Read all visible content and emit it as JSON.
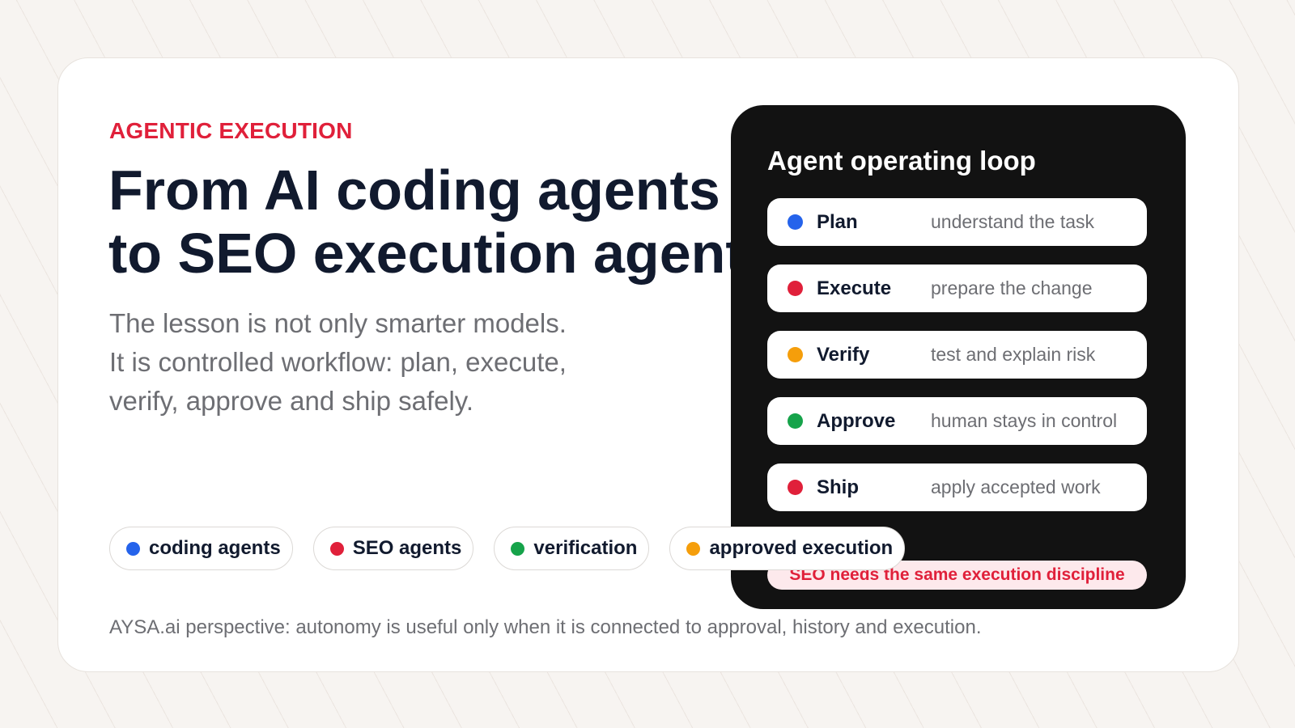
{
  "colors": {
    "accent_red": "#e0203a",
    "blue": "#2563eb",
    "red": "#e0203a",
    "green": "#16a34a",
    "orange": "#f59e0b",
    "ink": "#111a2e",
    "muted": "#6d6e73",
    "panel_bg": "#121212"
  },
  "hero": {
    "eyebrow": "AGENTIC EXECUTION",
    "headline_line1": "From AI coding agents",
    "headline_line2": "to SEO execution agents",
    "lede_line1": "The lesson is not only smarter models.",
    "lede_line2": "It is controlled workflow: plan, execute,",
    "lede_line3": "verify, approve and ship safely."
  },
  "tags": [
    {
      "label": "coding agents",
      "color": "#2563eb"
    },
    {
      "label": "SEO agents",
      "color": "#e0203a"
    },
    {
      "label": "verification",
      "color": "#16a34a"
    },
    {
      "label": "approved execution",
      "color": "#f59e0b"
    }
  ],
  "panel": {
    "title": "Agent operating loop",
    "steps": [
      {
        "label": "Plan",
        "desc": "understand the task",
        "color": "#2563eb"
      },
      {
        "label": "Execute",
        "desc": "prepare the change",
        "color": "#e0203a"
      },
      {
        "label": "Verify",
        "desc": "test and explain risk",
        "color": "#f59e0b"
      },
      {
        "label": "Approve",
        "desc": "human stays in control",
        "color": "#16a34a"
      },
      {
        "label": "Ship",
        "desc": "apply accepted work",
        "color": "#e0203a"
      }
    ],
    "discipline_note": "SEO needs the same execution discipline"
  },
  "footer": {
    "text": "AYSA.ai perspective: autonomy is useful only when it is connected to approval, history and execution."
  }
}
